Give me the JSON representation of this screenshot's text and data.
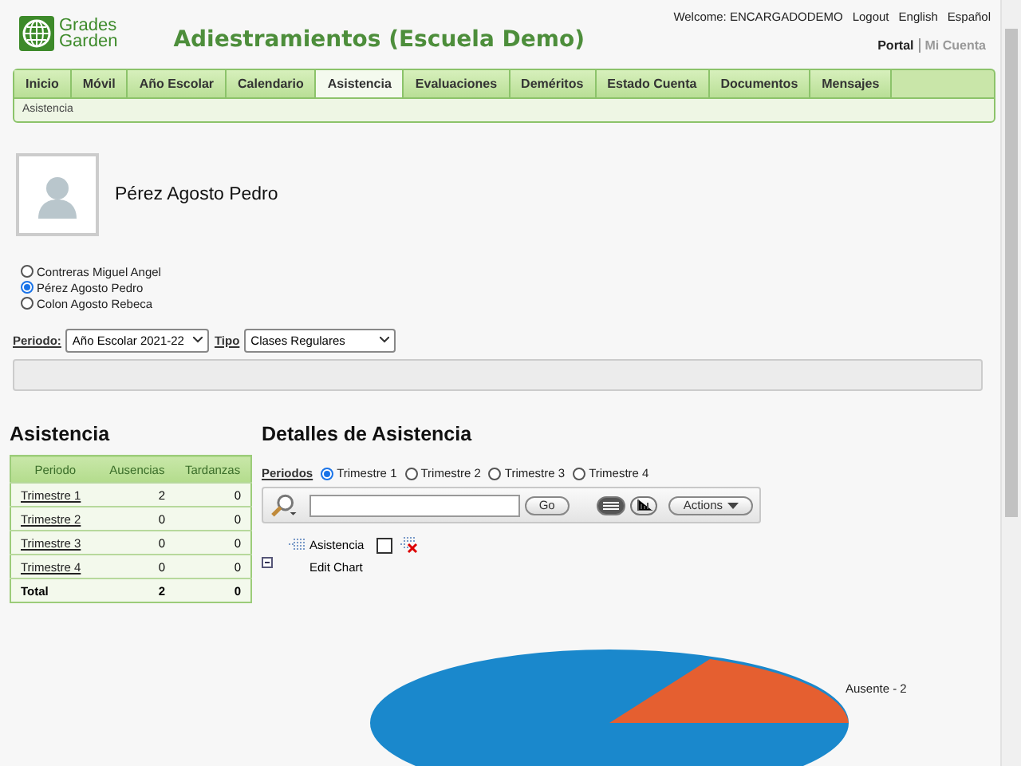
{
  "header": {
    "logo_lines": [
      "Grades",
      "Garden"
    ],
    "title": "Adiestramientos (Escuela Demo)",
    "user_links": [
      "Welcome: ENCARGADODEMO",
      "Logout",
      "English",
      "Español"
    ],
    "portal_links": [
      {
        "label": "Portal",
        "selected": true
      },
      {
        "label": "Mi Cuenta",
        "selected": false
      }
    ]
  },
  "tabs": [
    {
      "label": "Inicio",
      "selected": false
    },
    {
      "label": "Móvil",
      "selected": false
    },
    {
      "label": "Año Escolar",
      "selected": false
    },
    {
      "label": "Calendario",
      "selected": false
    },
    {
      "label": "Asistencia",
      "selected": true
    },
    {
      "label": "Evaluaciones",
      "selected": false
    },
    {
      "label": "Deméritos",
      "selected": false
    },
    {
      "label": "Estado Cuenta",
      "selected": false
    },
    {
      "label": "Documentos",
      "selected": false
    },
    {
      "label": "Mensajes",
      "selected": false
    }
  ],
  "breadcrumb": "Asistencia",
  "student": {
    "name": "Pérez Agosto Pedro"
  },
  "students": [
    {
      "label": "Contreras Miguel Angel",
      "selected": false
    },
    {
      "label": "Pérez Agosto Pedro",
      "selected": true
    },
    {
      "label": "Colon Agosto Rebeca",
      "selected": false
    }
  ],
  "filters": {
    "period_label": "Periodo:",
    "period_value": "Año Escolar 2021-22",
    "type_label": "Tipo",
    "type_value": "Clases Regulares"
  },
  "summary": {
    "title": "Asistencia",
    "columns": [
      "Periodo",
      "Ausencias",
      "Tardanzas"
    ],
    "rows": [
      {
        "cells": [
          "Trimestre 1",
          "2",
          "0"
        ],
        "total": false
      },
      {
        "cells": [
          "Trimestre 2",
          "0",
          "0"
        ],
        "total": false
      },
      {
        "cells": [
          "Trimestre 3",
          "0",
          "0"
        ],
        "total": false
      },
      {
        "cells": [
          "Trimestre 4",
          "0",
          "0"
        ],
        "total": false
      },
      {
        "cells": [
          "Total",
          "2",
          "0"
        ],
        "total": true
      }
    ]
  },
  "details": {
    "title": "Detalles de Asistencia",
    "periods_label": "Periodos",
    "periods": [
      {
        "label": "Trimestre 1",
        "selected": true
      },
      {
        "label": "Trimestre 2",
        "selected": false
      },
      {
        "label": "Trimestre 3",
        "selected": false
      },
      {
        "label": "Trimestre 4",
        "selected": false
      }
    ],
    "toolbar": {
      "go": "Go",
      "actions": "Actions",
      "views": [
        {
          "kind": "list",
          "selected": true
        },
        {
          "kind": "chart",
          "selected": false
        }
      ]
    },
    "report": {
      "label": "Asistencia",
      "checked": false,
      "edit": "Edit Chart"
    },
    "chart_label": "Ausente - 2"
  }
}
